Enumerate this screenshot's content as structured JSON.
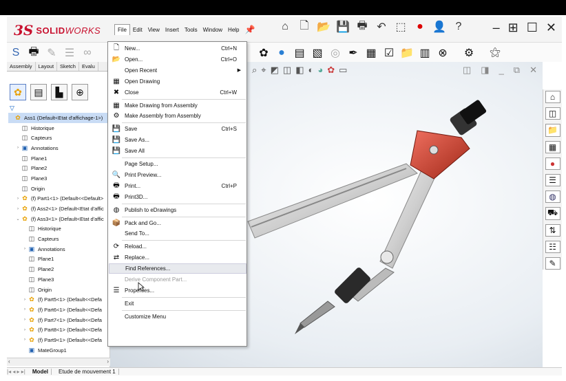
{
  "app": {
    "logo_ds": "3S",
    "logo_solid": "SOLID",
    "logo_works": "WORKS"
  },
  "menubar": [
    "File",
    "Edit",
    "View",
    "Insert",
    "Tools",
    "Window",
    "Help"
  ],
  "tabs": [
    "Assembly",
    "Layout",
    "Sketch",
    "Evalu"
  ],
  "filter_icon": "▽",
  "tree": [
    {
      "label": "Ass1  (Default<Etat d'affichage-1>)",
      "indent": 0,
      "twisty": "",
      "icon": "part",
      "sel": true
    },
    {
      "label": "Historique",
      "indent": 1,
      "twisty": "",
      "icon": "gray"
    },
    {
      "label": "Capteurs",
      "indent": 1,
      "twisty": "",
      "icon": "gray"
    },
    {
      "label": "Annotations",
      "indent": 1,
      "twisty": "›",
      "icon": "blue"
    },
    {
      "label": "Plane1",
      "indent": 1,
      "twisty": "",
      "icon": "gray"
    },
    {
      "label": "Plane2",
      "indent": 1,
      "twisty": "",
      "icon": "gray"
    },
    {
      "label": "Plane3",
      "indent": 1,
      "twisty": "",
      "icon": "gray"
    },
    {
      "label": "Origin",
      "indent": 1,
      "twisty": "",
      "icon": "gray"
    },
    {
      "label": "(f) Part1<1> (Default<<Default>",
      "indent": 1,
      "twisty": "›",
      "icon": "part"
    },
    {
      "label": "(f) Ass2<1> (Default<Etat d'affic",
      "indent": 1,
      "twisty": "›",
      "icon": "part"
    },
    {
      "label": "(f) Ass3<1> (Default<Etat d'affic",
      "indent": 1,
      "twisty": "⌄",
      "icon": "part"
    },
    {
      "label": "Historique",
      "indent": 2,
      "twisty": "",
      "icon": "gray"
    },
    {
      "label": "Capteurs",
      "indent": 2,
      "twisty": "",
      "icon": "gray"
    },
    {
      "label": "Annotations",
      "indent": 2,
      "twisty": "›",
      "icon": "blue"
    },
    {
      "label": "Plane1",
      "indent": 2,
      "twisty": "",
      "icon": "gray"
    },
    {
      "label": "Plane2",
      "indent": 2,
      "twisty": "",
      "icon": "gray"
    },
    {
      "label": "Plane3",
      "indent": 2,
      "twisty": "",
      "icon": "gray"
    },
    {
      "label": "Origin",
      "indent": 2,
      "twisty": "",
      "icon": "gray"
    },
    {
      "label": "(f) Part5<1> (Default<<Defa",
      "indent": 2,
      "twisty": "›",
      "icon": "part"
    },
    {
      "label": "(f) Part6<1> (Default<<Defa",
      "indent": 2,
      "twisty": "›",
      "icon": "part"
    },
    {
      "label": "(f) Part7<1> (Default<<Defa",
      "indent": 2,
      "twisty": "›",
      "icon": "part"
    },
    {
      "label": "(f) Part8<1> (Default<<Defa",
      "indent": 2,
      "twisty": "›",
      "icon": "part"
    },
    {
      "label": "(f) Part9<1> (Default<<Defa",
      "indent": 2,
      "twisty": "›",
      "icon": "part"
    },
    {
      "label": "MateGroup1",
      "indent": 2,
      "twisty": "",
      "icon": "blue"
    }
  ],
  "bottom_tabs": [
    "Model",
    "Etude de mouvement 1"
  ],
  "file_menu": [
    {
      "label": "New...",
      "shortcut": "Ctrl+N",
      "icon": "🗋"
    },
    {
      "label": "Open...",
      "shortcut": "Ctrl+O",
      "icon": "📂"
    },
    {
      "label": "Open Recent",
      "shortcut": "",
      "icon": "",
      "submenu": true
    },
    {
      "label": "Open Drawing",
      "shortcut": "",
      "icon": "▦"
    },
    {
      "label": "Close",
      "shortcut": "Ctrl+W",
      "icon": "✖"
    },
    {
      "sep": true
    },
    {
      "label": "Make Drawing from Assembly",
      "shortcut": "",
      "icon": "▦"
    },
    {
      "label": "Make Assembly from Assembly",
      "shortcut": "",
      "icon": "⚙"
    },
    {
      "sep": true
    },
    {
      "label": "Save",
      "shortcut": "Ctrl+S",
      "icon": "💾"
    },
    {
      "label": "Save As...",
      "shortcut": "",
      "icon": "💾"
    },
    {
      "label": "Save All",
      "shortcut": "",
      "icon": "💾"
    },
    {
      "sep": true
    },
    {
      "label": "Page Setup...",
      "shortcut": "",
      "icon": ""
    },
    {
      "label": "Print Preview...",
      "shortcut": "",
      "icon": "🔍"
    },
    {
      "label": "Print...",
      "shortcut": "Ctrl+P",
      "icon": "🖶"
    },
    {
      "label": "Print3D...",
      "shortcut": "",
      "icon": "🖶"
    },
    {
      "sep": true
    },
    {
      "label": "Publish to eDrawings",
      "shortcut": "",
      "icon": "◍"
    },
    {
      "sep": true
    },
    {
      "label": "Pack and Go...",
      "shortcut": "",
      "icon": "📦"
    },
    {
      "label": "Send To...",
      "shortcut": "",
      "icon": ""
    },
    {
      "sep": true
    },
    {
      "label": "Reload...",
      "shortcut": "",
      "icon": "⟳"
    },
    {
      "label": "Replace...",
      "shortcut": "",
      "icon": "⇄"
    },
    {
      "label": "Find References...",
      "shortcut": "",
      "icon": "",
      "hover": true
    },
    {
      "label": "Derive Component Part...",
      "shortcut": "",
      "icon": "",
      "disabled": true
    },
    {
      "label": "Properties...",
      "shortcut": "",
      "icon": "☰"
    },
    {
      "sep": true
    },
    {
      "label": "Exit",
      "shortcut": "",
      "icon": ""
    },
    {
      "sep": true
    },
    {
      "label": "Customize Menu",
      "shortcut": "",
      "icon": ""
    }
  ],
  "colors": {
    "brand_red": "#c8102e",
    "selection": "#c9dcf5"
  }
}
